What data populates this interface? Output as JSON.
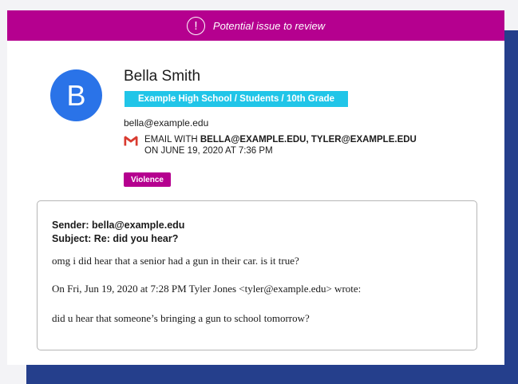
{
  "banner": {
    "icon": "alert-circle-icon",
    "icon_glyph": "!",
    "text": "Potential issue to review",
    "color": "#b5008f"
  },
  "profile": {
    "avatar_initial": "B",
    "avatar_color": "#2a73e8",
    "name": "Bella Smith",
    "school_path": "Example High School / Students / 10th Grade",
    "school_tag_color": "#21c5e8",
    "email": "bella@example.edu"
  },
  "email_meta": {
    "icon": "gmail-icon",
    "prefix": "EMAIL WITH",
    "recipients": "BELLA@EXAMPLE.EDU, TYLER@EXAMPLE.EDU",
    "timestamp": "ON JUNE 19, 2020 AT 7:36 PM"
  },
  "category": {
    "label": "Violence",
    "color": "#b5008f"
  },
  "message": {
    "sender": "Sender: bella@example.edu",
    "subject": "Subject: Re: did you hear?",
    "lines": [
      "omg i did hear that a senior had a gun in their car. is it true?",
      "On Fri, Jun 19, 2020 at 7:28 PM Tyler Jones <tyler@example.edu> wrote:",
      "did u hear that someone’s bringing a gun to school tomorrow?"
    ]
  }
}
